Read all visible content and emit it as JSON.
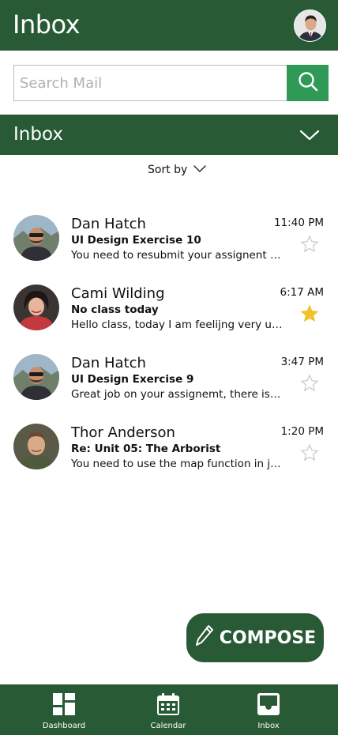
{
  "header": {
    "title": "Inbox"
  },
  "search": {
    "placeholder": "Search Mail"
  },
  "folder": {
    "title": "Inbox"
  },
  "sort": {
    "label": "Sort by"
  },
  "messages": [
    {
      "sender": "Dan Hatch",
      "subject": "UI Design Exercise 10",
      "preview": "You need to resubmit your assignent you turned in",
      "time": "11:40 PM",
      "starred": false
    },
    {
      "sender": "Cami Wilding",
      "subject": "No class today",
      "preview": "Hello class, today I am feelijng very under the weather",
      "time": "6:17 AM",
      "starred": true
    },
    {
      "sender": "Dan Hatch",
      "subject": "UI Design Exercise 9",
      "preview": "Great job on your assignemt, there is just one thing",
      "time": "3:47 PM",
      "starred": false
    },
    {
      "sender": "Thor Anderson",
      "subject": "Re: Unit 05: The Arborist",
      "preview": "You need to use the map function in javascript",
      "time": "1:20 PM",
      "starred": false
    }
  ],
  "compose": {
    "label": "COMPOSE"
  },
  "nav": [
    {
      "label": "Dashboard",
      "icon": "dashboard-icon"
    },
    {
      "label": "Calendar",
      "icon": "calendar-icon"
    },
    {
      "label": "Inbox",
      "icon": "inbox-icon"
    }
  ],
  "colors": {
    "primary": "#285a35",
    "search_button": "#2e9a55",
    "star_active": "#f2c22a",
    "star_inactive": "#c8c8c8"
  }
}
